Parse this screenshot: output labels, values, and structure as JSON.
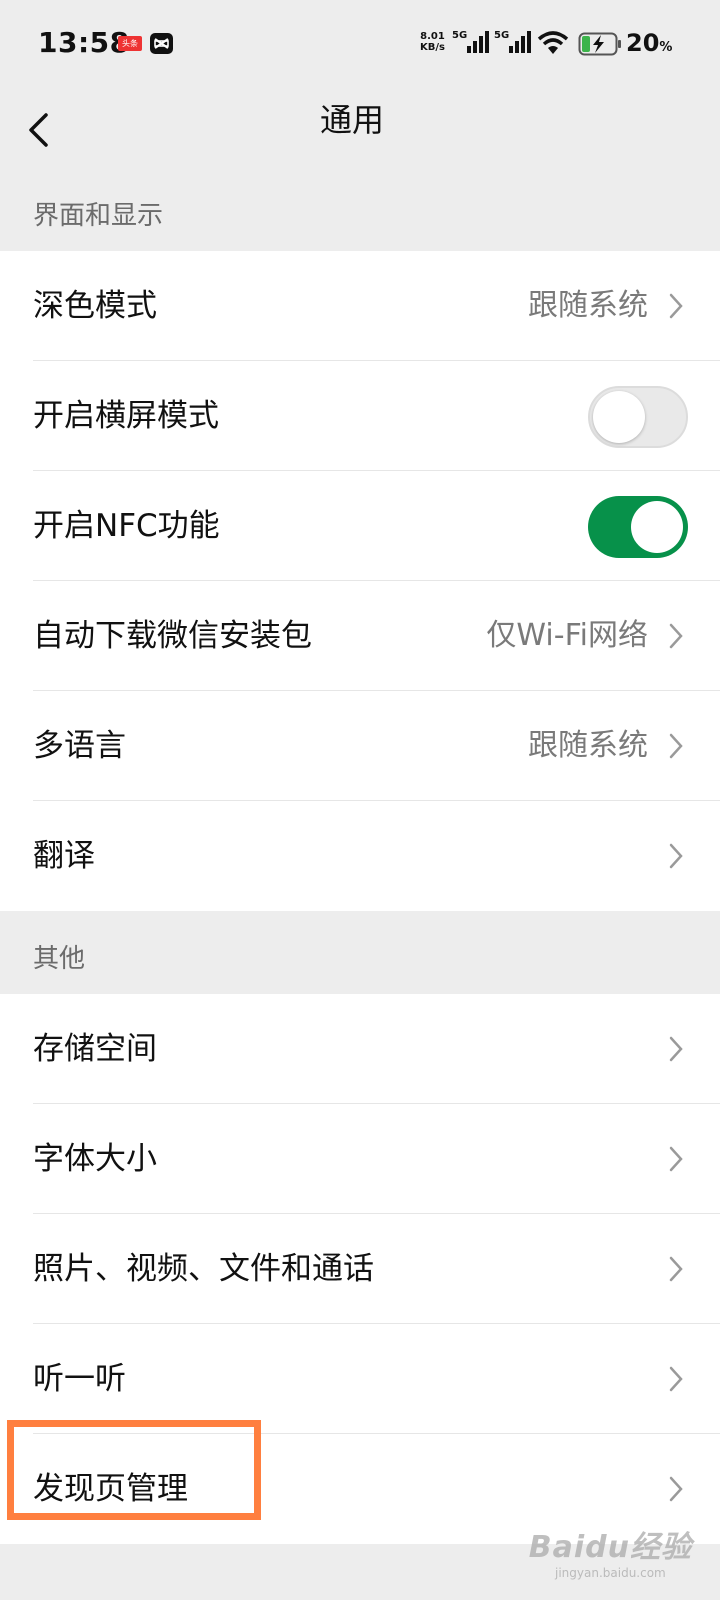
{
  "status_bar": {
    "time": "13:58",
    "app_badge_1": "头条",
    "net_speed_value": "8.01",
    "net_speed_unit": "KB/s",
    "sim1_type": "5G",
    "sim2_type": "5G",
    "battery_percent": "20",
    "battery_percent_sign": "%"
  },
  "nav": {
    "title": "通用"
  },
  "sections": [
    {
      "header": "界面和显示",
      "rows": [
        {
          "label": "深色模式",
          "value": "跟随系统",
          "control": "chevron"
        },
        {
          "label": "开启横屏模式",
          "control": "toggle",
          "on": false
        },
        {
          "label": "开启NFC功能",
          "control": "toggle",
          "on": true
        },
        {
          "label": "自动下载微信安装包",
          "value": "仅Wi-Fi网络",
          "control": "chevron"
        },
        {
          "label": "多语言",
          "value": "跟随系统",
          "control": "chevron"
        },
        {
          "label": "翻译",
          "control": "chevron"
        }
      ]
    },
    {
      "header": "其他",
      "rows": [
        {
          "label": "存储空间",
          "control": "chevron"
        },
        {
          "label": "字体大小",
          "control": "chevron"
        },
        {
          "label": "照片、视频、文件和通话",
          "control": "chevron"
        },
        {
          "label": "听一听",
          "control": "chevron"
        },
        {
          "label": "发现页管理",
          "control": "chevron"
        }
      ]
    }
  ],
  "highlight_color": "#ff7f3f",
  "toggle_on_color": "#07914a",
  "watermark": {
    "main": "Baidu经验",
    "sub": "jingyan.baidu.com"
  }
}
